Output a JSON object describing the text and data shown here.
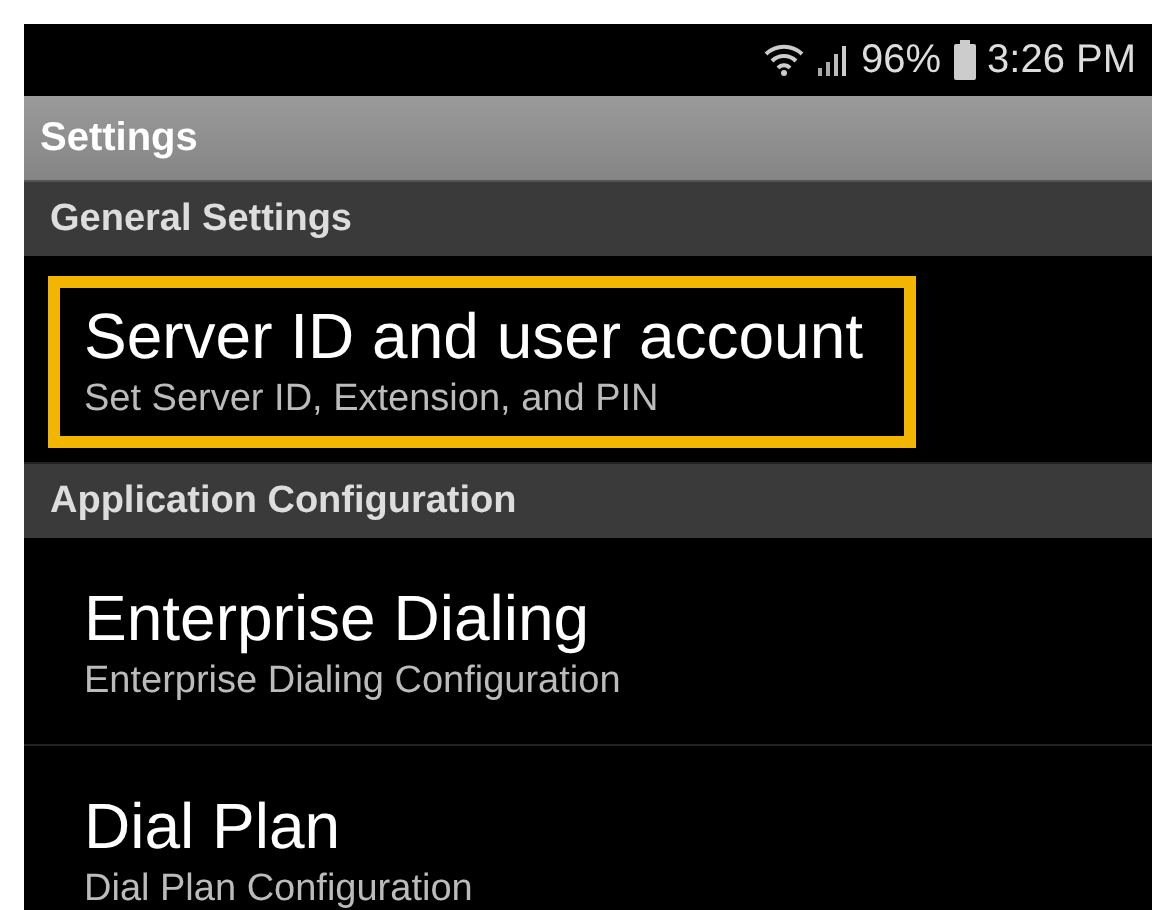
{
  "status_bar": {
    "battery": "96%",
    "time": "3:26 PM"
  },
  "app_bar": {
    "title": "Settings"
  },
  "sections": [
    {
      "header": "General Settings",
      "items": [
        {
          "title": "Server ID and user account",
          "summary": "Set Server ID, Extension, and PIN",
          "highlighted": true
        }
      ]
    },
    {
      "header": "Application Configuration",
      "items": [
        {
          "title": "Enterprise Dialing",
          "summary": "Enterprise Dialing Configuration",
          "highlighted": false
        },
        {
          "title": "Dial Plan",
          "summary": "Dial Plan Configuration",
          "highlighted": false
        }
      ]
    }
  ]
}
